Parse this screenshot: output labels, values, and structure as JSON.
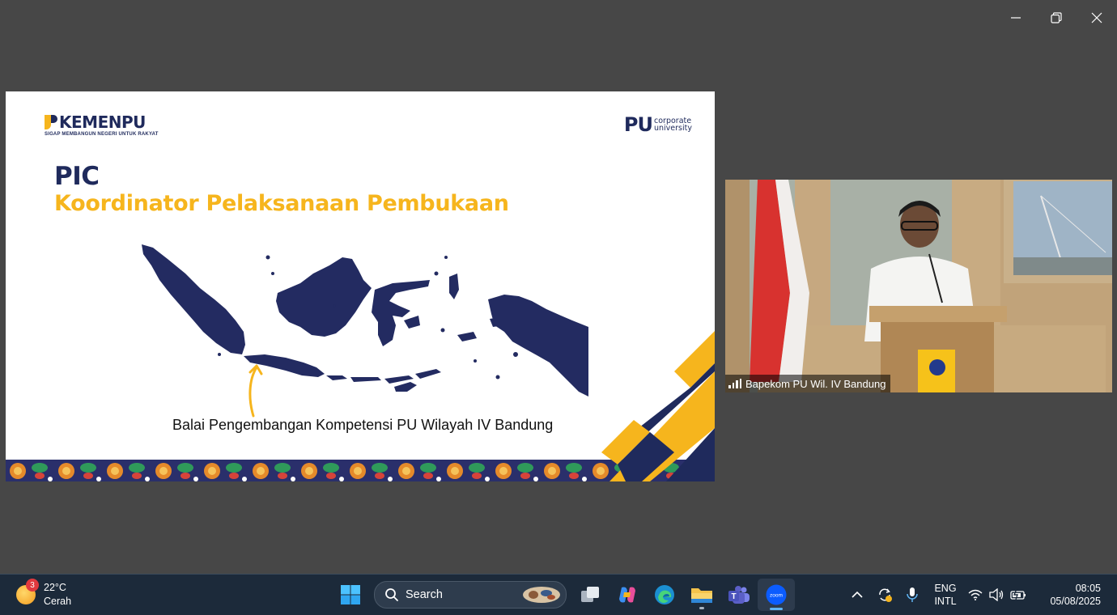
{
  "window": {
    "controls": [
      {
        "name": "minimize-icon"
      },
      {
        "name": "restore-icon"
      },
      {
        "name": "close-icon"
      }
    ]
  },
  "slide": {
    "logo_left": {
      "part1": "KEMEN",
      "part2": "PU",
      "tagline": "SIGAP MEMBANGUN NEGERI UNTUK RAKYAT"
    },
    "logo_right": {
      "letters": "PU",
      "line1": "corporate",
      "line2": "university"
    },
    "title": "PIC",
    "subtitle": "Koordinator Pelaksanaan Pembukaan",
    "caption": "Balai Pengembangan Kompetensi PU Wilayah IV Bandung",
    "colors": {
      "navy": "#1f2a5c",
      "gold": "#f6b51d"
    }
  },
  "video": {
    "participant_name": "Bapekom PU Wil. IV Bandung"
  },
  "taskbar": {
    "weather": {
      "badge": "3",
      "temp": "22°C",
      "condition": "Cerah"
    },
    "search_label": "Search",
    "apps": [
      {
        "name": "start-icon"
      },
      {
        "name": "task-view-icon"
      },
      {
        "name": "copilot-icon"
      },
      {
        "name": "edge-icon"
      },
      {
        "name": "file-explorer-icon"
      },
      {
        "name": "teams-icon"
      },
      {
        "name": "zoom-icon",
        "label": "zoom"
      }
    ],
    "language": {
      "line1": "ENG",
      "line2": "INTL"
    },
    "clock": {
      "time": "08:05",
      "date": "05/08/2025"
    }
  }
}
